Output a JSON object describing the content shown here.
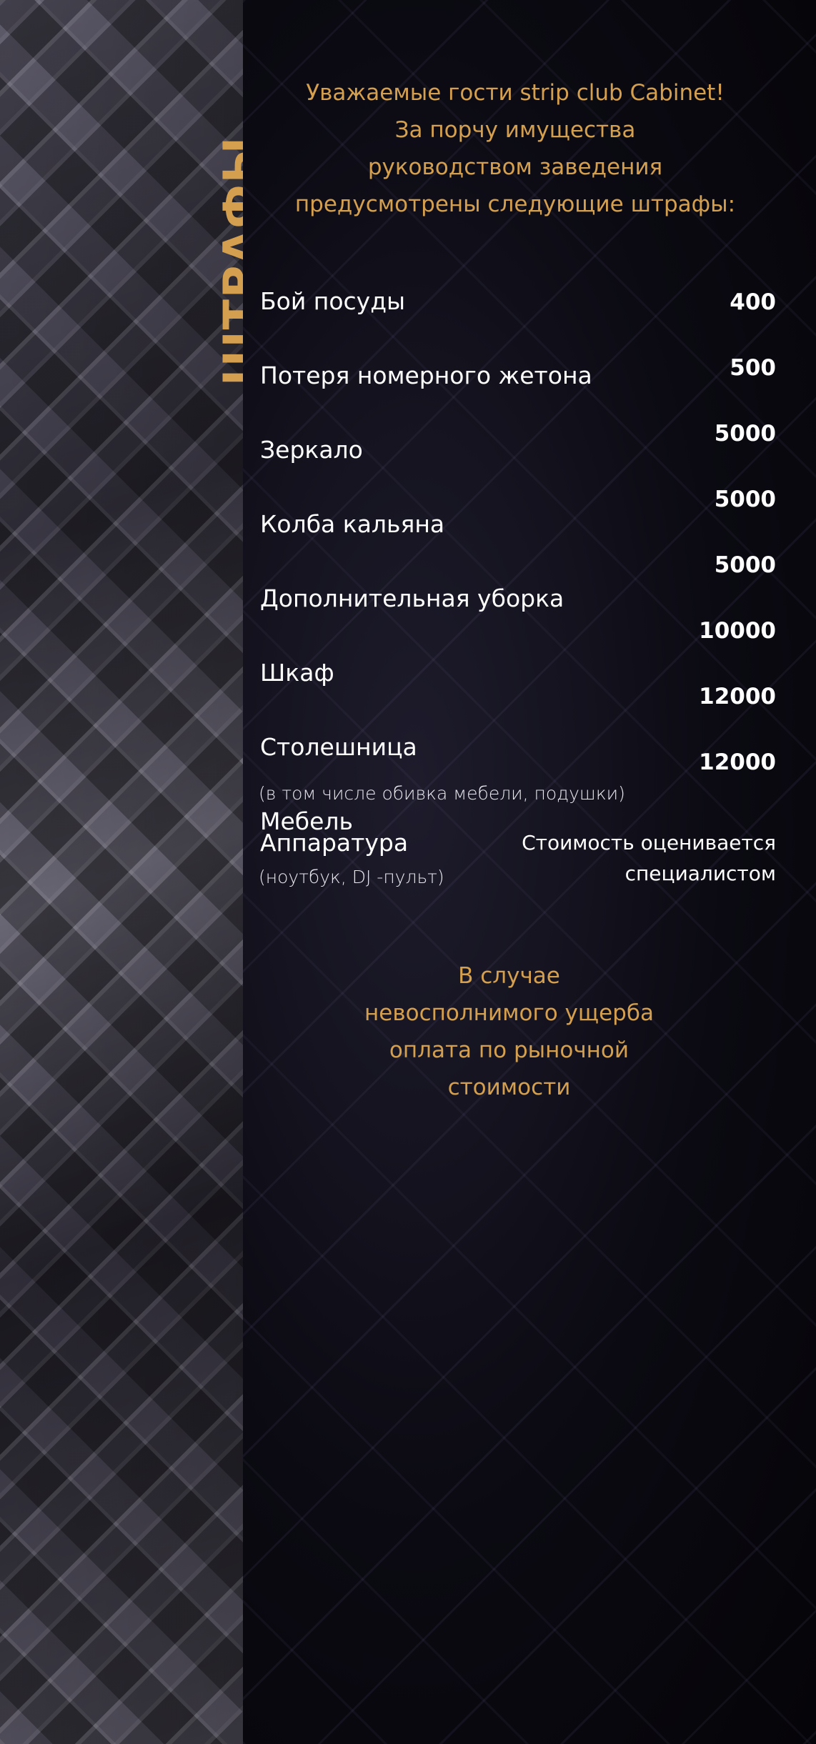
{
  "sidebar": {
    "title": "ШТРАФЫ"
  },
  "intro": {
    "lines": [
      "Уважаемые гости strip club Cabinet!",
      "За порчу имущества",
      "руководством заведения",
      "предусмотрены следующие штрафы:"
    ]
  },
  "fines": {
    "items": [
      {
        "name": "Бой посуды"
      },
      {
        "name": "Потеря номерного жетона"
      },
      {
        "name": "Зеркало"
      },
      {
        "name": "Колба кальяна"
      },
      {
        "name": "Дополнительная уборка"
      },
      {
        "name": "Шкаф"
      },
      {
        "name": "Столешница"
      },
      {
        "name": "Мебель"
      },
      {
        "name": "Аппаратура"
      }
    ],
    "prices": [
      "400",
      "500",
      "5000",
      "5000",
      "5000",
      "10000",
      "12000",
      "12000"
    ],
    "furniture_note": "(в том числе обивка мебели, подушки)",
    "equipment_note": "(ноутбук, DJ -пульт)",
    "assessment": [
      "Стоимость оценивается",
      "специалистом"
    ]
  },
  "outro": {
    "lines": [
      "В случае",
      "невосполнимого ущерба",
      "оплата по рыночной",
      "стоимости"
    ]
  },
  "colors": {
    "accent": "#d4a04f",
    "background": "#05040a",
    "text": "#ffffff"
  }
}
